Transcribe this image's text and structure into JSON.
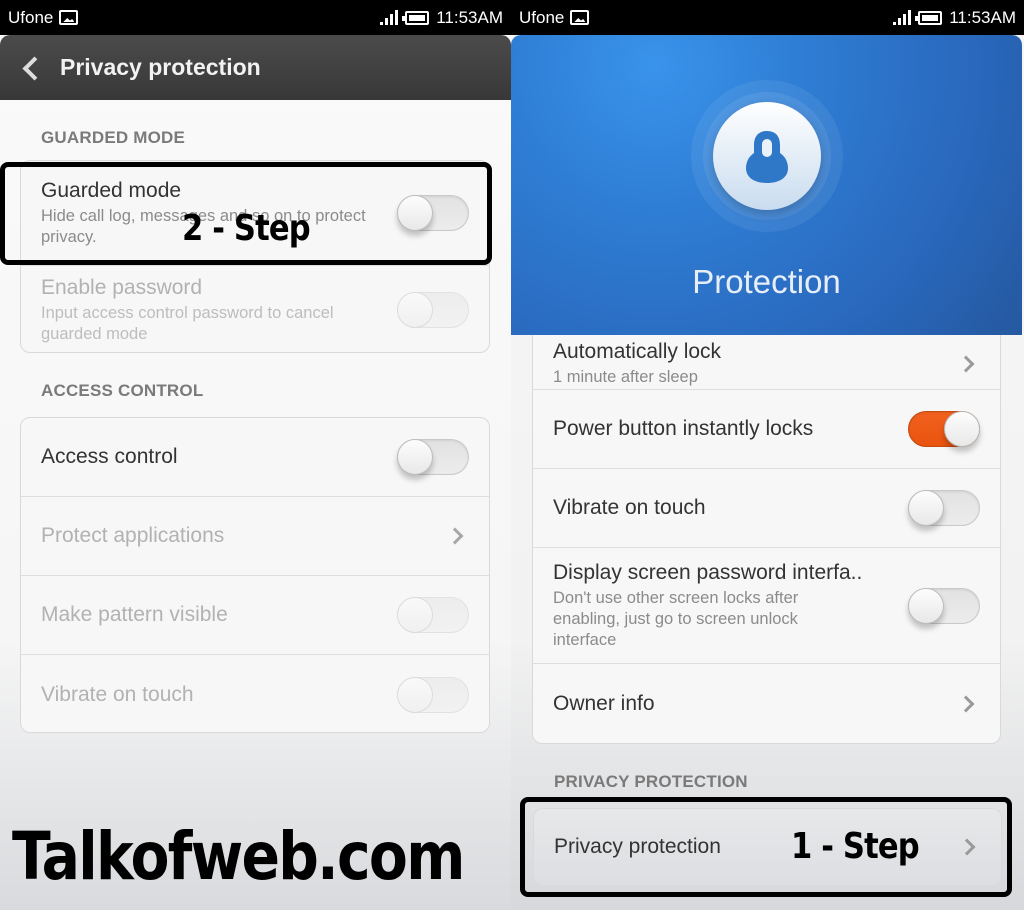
{
  "left_screen": {
    "status_bar": {
      "carrier": "Ufone",
      "time": "11:53AM"
    },
    "title_bar": {
      "title": "Privacy protection"
    },
    "sections": {
      "guarded": {
        "header": "GUARDED MODE",
        "rows": [
          {
            "label": "Guarded mode",
            "sub": "Hide call log, messages and so on to protect privacy.",
            "toggle": false,
            "enabled": true
          },
          {
            "label": "Enable password",
            "sub": "Input access control password to cancel guarded mode",
            "toggle": false,
            "enabled": false
          }
        ]
      },
      "access": {
        "header": "ACCESS CONTROL",
        "rows": [
          {
            "label": "Access control",
            "toggle": false,
            "enabled": true
          },
          {
            "label": "Protect applications",
            "enabled": false
          },
          {
            "label": "Make pattern visible",
            "toggle": false,
            "enabled": false
          },
          {
            "label": "Vibrate on touch",
            "toggle": false,
            "enabled": false
          }
        ]
      }
    },
    "annotation": "2 - Step",
    "watermark": "Talkofweb.com"
  },
  "right_screen": {
    "status_bar": {
      "carrier": "Ufone",
      "time": "11:53AM"
    },
    "hero": {
      "title": "Protection",
      "accent": "#2f7fd6"
    },
    "rows": [
      {
        "label": "Automatically lock",
        "sub": "1 minute after sleep"
      },
      {
        "label": "Power button instantly locks",
        "toggle": true
      },
      {
        "label": "Vibrate on touch",
        "toggle": false
      },
      {
        "label": "Display screen password interfa..",
        "sub": "Don't use other screen locks after enabling, just go to screen unlock interface",
        "toggle": false
      },
      {
        "label": "Owner info"
      }
    ],
    "privacy_section": {
      "header": "PRIVACY PROTECTION",
      "row": {
        "label": "Privacy protection"
      }
    },
    "annotation": "1 - Step",
    "toggle_on_color": "#ee5a16"
  }
}
